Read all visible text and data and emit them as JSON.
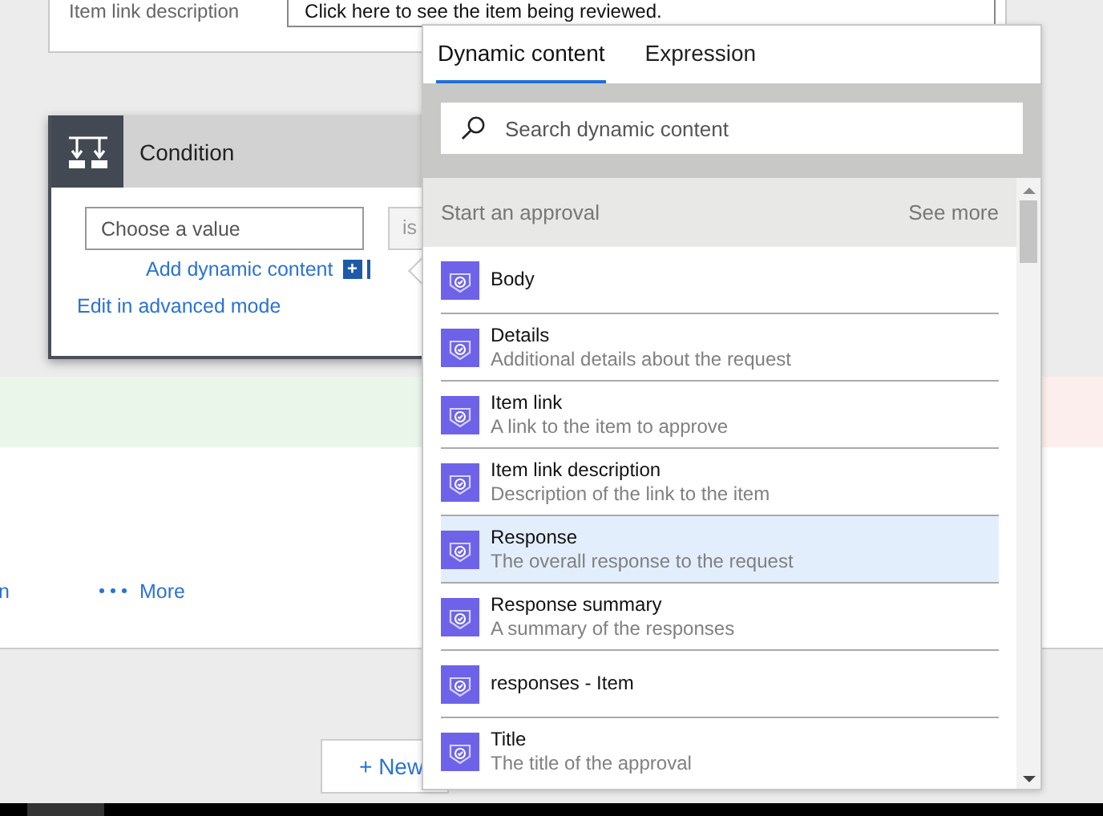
{
  "top_card": {
    "label": "Item link description",
    "value": "Click here to see the item being reviewed."
  },
  "condition": {
    "title": "Condition",
    "value_field": {
      "placeholder": "Choose a value"
    },
    "operator": "is",
    "add_dynamic_content": "Add dynamic content",
    "plus": "+",
    "advanced_mode": "Edit in advanced mode"
  },
  "background_actions": {
    "cut_text": "n",
    "more": "More"
  },
  "new_button": "+ New",
  "popup": {
    "tabs": [
      {
        "label": "Dynamic content",
        "selected": true
      },
      {
        "label": "Expression",
        "selected": false
      }
    ],
    "search": {
      "placeholder": "Search dynamic content"
    },
    "section": {
      "title": "Start an approval",
      "see_more": "See more"
    },
    "items": [
      {
        "name": "Body",
        "selected": false
      },
      {
        "name": "Details",
        "description": "Additional details about the request",
        "selected": false
      },
      {
        "name": "Item link",
        "description": "A link to the item to approve",
        "selected": false
      },
      {
        "name": "Item link description",
        "description": "Description of the link to the item",
        "selected": false
      },
      {
        "name": "Response",
        "description": "The overall response to the request",
        "selected": true
      },
      {
        "name": "Response summary",
        "description": "A summary of the responses",
        "selected": false
      },
      {
        "name": "responses - Item",
        "selected": false
      },
      {
        "name": "Title",
        "description": "The title of the approval",
        "selected": false
      }
    ]
  }
}
